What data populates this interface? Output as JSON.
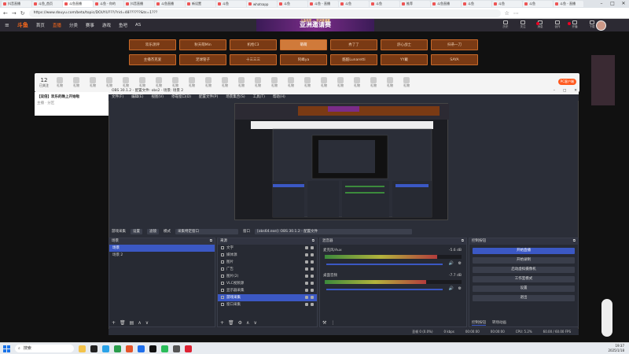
{
  "browser": {
    "tabs": [
      "抖音直播",
      "斗鱼_首页",
      "斗鱼直播",
      "斗鱼 - 你的",
      "抖音直播",
      "斗鱼直播",
      "新设置",
      "斗鱼",
      "whatsapp",
      "斗鱼",
      "斗鱼 - 直播",
      "斗鱼",
      "斗鱼",
      "推荐",
      "斗鱼直播",
      "斗鱼",
      "斗鱼",
      "斗鱼",
      "斗鱼 - 直播"
    ],
    "url": "https://www.douyu.com/beta/topic/DOUYU???/?rid=48??????&ts=1???",
    "window_controls": [
      "–",
      "□",
      "✕"
    ]
  },
  "site": {
    "logo": "斗鱼",
    "nav": [
      "首页",
      "直播",
      "分类",
      "赛事",
      "游戏",
      "鱼吧",
      "AS"
    ],
    "banner_small": "斗鱼电竞 — 亚洲邀请赛",
    "banner": "亚洲邀请赛",
    "header_icons": [
      "历史",
      "关注",
      "消息",
      "创作",
      "开播",
      "下载"
    ]
  },
  "categories": [
    {
      "label": "欢乐测评",
      "selected": false
    },
    {
      "label": "秋天萌Min",
      "selected": false
    },
    {
      "label": "机枪C3",
      "selected": false
    },
    {
      "label": "萌萌",
      "selected": true
    },
    {
      "label": "秀了了",
      "selected": false
    },
    {
      "label": "舒心战士",
      "selected": false
    },
    {
      "label": "扫帚一刀",
      "selected": false
    },
    {
      "label": "主播杰克爱",
      "selected": false
    },
    {
      "label": "足球管子",
      "selected": false
    },
    {
      "label": "十三三三",
      "selected": false
    },
    {
      "label": "阿峰ya",
      "selected": false
    },
    {
      "label": "酷酷Lunaretti",
      "selected": false
    },
    {
      "label": "YY戴",
      "selected": false
    },
    {
      "label": "SAYA",
      "selected": false
    }
  ],
  "giftbar": {
    "count": "12",
    "count_label": "已关注",
    "gifts": [
      "礼物",
      "礼物",
      "礼物",
      "礼物",
      "礼物",
      "礼物",
      "礼物",
      "礼物",
      "礼物",
      "礼物",
      "礼物",
      "礼物",
      "礼物",
      "礼物",
      "礼物",
      "礼物",
      "礼物",
      "礼物",
      "礼物",
      "礼物",
      "礼物",
      "礼物"
    ],
    "pc_button": "PC客户端"
  },
  "room": {
    "title": "【双倍】欢乐的晚上开始啦",
    "meta": "主播 · 分区"
  },
  "obs": {
    "title": "OBS 30.1.2 - 配置文件: obs2 - 场景: 场景 2",
    "menu": [
      "文件(F)",
      "编辑(E)",
      "视图(V)",
      "停靠窗口(D)",
      "配置文件(P)",
      "场景集合(S)",
      "工具(T)",
      "帮助(H)"
    ],
    "transport": {
      "label": "游戏采集",
      "buttons": [
        "设置",
        "滤镜"
      ],
      "mode_label": "模式",
      "mode": "采集特定窗口",
      "window_label": "窗口",
      "window": "[obs64.exe]: OBS 30.1.2 - 配置文件"
    },
    "scenes": {
      "title": "场景",
      "items": [
        {
          "label": "场景",
          "selected": true
        },
        {
          "label": "场景 2",
          "selected": false
        }
      ]
    },
    "sources": {
      "title": "来源",
      "items": [
        {
          "label": "文字",
          "selected": false
        },
        {
          "label": "媒体源",
          "selected": false
        },
        {
          "label": "图片",
          "selected": false
        },
        {
          "label": "广告",
          "selected": false
        },
        {
          "label": "图片(2)",
          "selected": false
        },
        {
          "label": "VLC视频源",
          "selected": false
        },
        {
          "label": "显示器采集",
          "selected": false
        },
        {
          "label": "游戏采集",
          "selected": true
        },
        {
          "label": "窗口采集",
          "selected": false
        }
      ]
    },
    "mixer": {
      "title": "混音器",
      "tracks": [
        {
          "name": "麦克风/Aux",
          "db": "-5.6 dB",
          "level": 0.82
        },
        {
          "name": "桌面音频",
          "db": "-7.7 dB",
          "level": 0.74
        }
      ]
    },
    "controls": {
      "title": "控制按钮",
      "buttons": [
        "开始直播",
        "开始录制",
        "启动虚拟摄像机",
        "工作室模式",
        "设置",
        "退出"
      ]
    },
    "tabs": [
      "控制按钮",
      "转场动画"
    ],
    "status": [
      "丢帧 0 (0.0%)",
      "0 kbps",
      "00:00:00",
      "00:00:00",
      "CPU: 5.2%",
      "60.00 / 60.00 FPS"
    ]
  },
  "taskbar": {
    "search": "搜索",
    "time": "19:37",
    "date": "2025/1/18"
  },
  "colors": {
    "accent": "#3b58c4",
    "brand": "#ff6a1a"
  }
}
